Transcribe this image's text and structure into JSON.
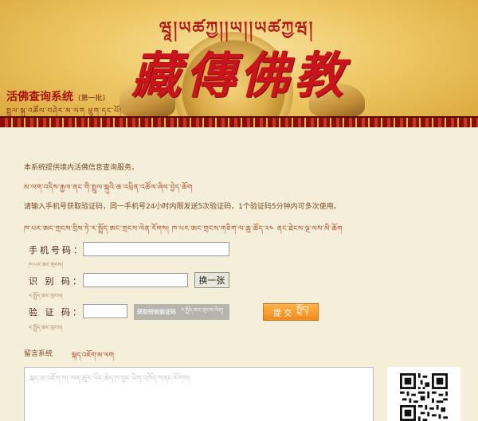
{
  "banner": {
    "tibetan_title": "ཝཱ།ཡཚཀྱ།།ཡ།།ཡཚཀྱཝ།",
    "main_title": "藏傳佛教",
    "system_name": "活佛查询系统",
    "batch": "(第一批)",
    "system_name_tibetan": "སྤྲུལ་སྐུ་འཚོལ་བཤེར་མ་ལག  ཕྲུག་དང་པོ།"
  },
  "content": {
    "intro_cn": "本系统提供境内活佛信息查询服务。",
    "intro_tib": "མ་ལག་འདིས་རྒྱལ་ནང་གི་སྤྲུལ་སྐུའི་ཆ་འཕྲིན་འཚོལ་ཞིབ་བྱེད་ཆོག",
    "instructions_cn": "请输入手机号获取验证码，同一手机号24小时内限发送5次验证码，1个验证码5分钟内可多次使用。",
    "instructions_tib": "ཁ་པར་ཨང་གྲངས་བྲིས་ཏེ་ར་སྤྲོད་ཨང་གྲངས་ལེན་རོགས། ཁ་པར་ཨང་གྲངས་གཅིག་ལ་ཆུ་ཚོད་༢༤ ནང་ཐེངས་ལྔ་ལས་མི་ཆོག",
    "phone_label": "手机号码：",
    "phone_label_tib": "ཁ་པར་ཨང་གྲངས།",
    "phone_value": "",
    "code_label": "识 别 码：",
    "code_label_tib": "ར་སྤྲོད་ཨང་གྲངས།",
    "code_value": "",
    "refresh_label": "换一张",
    "verify_label": "验 证 码：",
    "verify_label_tib": "ར་སྤྲོད་ཨང་གྲངས།",
    "verify_value": "",
    "captcha_main": "获取短信验证码",
    "captcha_tib": "ར་སྤྲོད་ཨང་གྲངས་ལེན།",
    "submit_label": "提 交",
    "submit_tib": "སྤྲོད།",
    "message_title": "留言系统",
    "message_title_tib": "སྐད་འཇོག་མ་ལག",
    "message_placeholder": "སྐད་ཆ་འཇོག་ས། ལན་ཚུར་ཡོང་ཆེད་ཁ་བྱང་ཡིག་འཁོད་གནང་རོགས།"
  },
  "colors": {
    "page_bg": "#f5efd9",
    "banner_red": "#c8141a",
    "submit_orange": "#f08a1c"
  }
}
